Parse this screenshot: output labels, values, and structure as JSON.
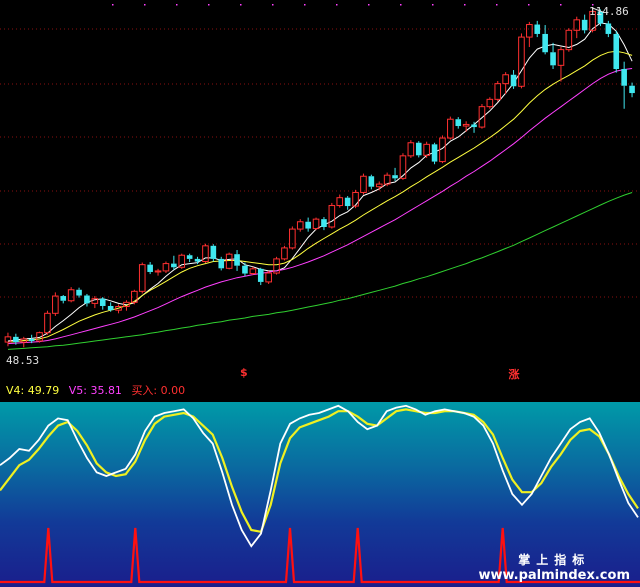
{
  "main_chart": {
    "high_label": "114.86",
    "low_label": "48.53",
    "signals": [
      {
        "text": "$",
        "date_index": 30
      },
      {
        "text": "涨",
        "date_index": 64
      }
    ]
  },
  "indicator_legend": {
    "v4": "V4: 49.79",
    "v5": "V5: 35.81",
    "buy": "买入: 0.00",
    "colors": {
      "v4": "#ffff40",
      "v5": "#ff40ff",
      "buy": "#ff3030"
    }
  },
  "watermark": {
    "cn": "掌上指标",
    "url": "www.palmindex.com"
  },
  "colors": {
    "up": "#ff3030",
    "down": "#40e8f0",
    "ma_short": "#ffffff",
    "ma_mid": "#ffff40",
    "ma_long": "#ff40ff",
    "ma_longer": "#30d030",
    "k_line": "#ffffff",
    "d_line": "#f0f020",
    "buy_line": "#ff1010"
  },
  "chart_data": [
    {
      "type": "candlestick",
      "title": "",
      "ylim": [
        48.53,
        114.86
      ],
      "candles": [
        [
          51.0,
          52.8,
          50.2,
          52.0
        ],
        [
          52.0,
          52.6,
          50.5,
          51.0
        ],
        [
          51.0,
          52.0,
          50.0,
          51.6
        ],
        [
          51.6,
          52.4,
          50.8,
          51.2
        ],
        [
          51.2,
          53.0,
          50.9,
          52.8
        ],
        [
          52.8,
          57.0,
          52.4,
          56.5
        ],
        [
          56.5,
          60.5,
          56.0,
          59.8
        ],
        [
          59.8,
          60.0,
          58.4,
          58.9
        ],
        [
          58.9,
          61.5,
          58.6,
          61.0
        ],
        [
          61.0,
          61.4,
          59.5,
          59.9
        ],
        [
          59.9,
          60.2,
          57.8,
          58.4
        ],
        [
          58.4,
          59.8,
          57.5,
          59.3
        ],
        [
          59.3,
          59.6,
          57.2,
          57.9
        ],
        [
          57.9,
          58.6,
          56.8,
          57.1
        ],
        [
          57.1,
          58.2,
          56.5,
          57.8
        ],
        [
          57.8,
          59.0,
          57.0,
          58.6
        ],
        [
          58.6,
          61.0,
          58.2,
          60.7
        ],
        [
          60.7,
          66.2,
          60.3,
          65.8
        ],
        [
          65.8,
          66.3,
          64.0,
          64.4
        ],
        [
          64.4,
          65.0,
          63.7,
          64.6
        ],
        [
          64.6,
          66.4,
          64.2,
          66.0
        ],
        [
          66.0,
          67.5,
          64.8,
          65.3
        ],
        [
          65.3,
          67.9,
          65.0,
          67.6
        ],
        [
          67.6,
          67.9,
          66.3,
          66.9
        ],
        [
          66.9,
          67.3,
          65.9,
          66.4
        ],
        [
          66.4,
          69.8,
          66.1,
          69.4
        ],
        [
          69.4,
          69.7,
          66.4,
          66.9
        ],
        [
          66.9,
          67.3,
          64.7,
          65.1
        ],
        [
          65.1,
          68.1,
          64.9,
          67.8
        ],
        [
          67.8,
          68.6,
          64.6,
          65.6
        ],
        [
          65.6,
          66.2,
          63.6,
          64.1
        ],
        [
          64.1,
          65.4,
          63.8,
          65.0
        ],
        [
          65.0,
          65.2,
          61.9,
          62.5
        ],
        [
          62.5,
          64.6,
          62.1,
          64.2
        ],
        [
          64.2,
          67.3,
          63.9,
          66.9
        ],
        [
          66.9,
          69.4,
          66.6,
          69.0
        ],
        [
          69.0,
          73.1,
          68.7,
          72.6
        ],
        [
          72.6,
          74.5,
          72.1,
          74.0
        ],
        [
          74.0,
          74.8,
          72.1,
          72.7
        ],
        [
          72.7,
          74.8,
          72.4,
          74.5
        ],
        [
          74.5,
          74.9,
          72.4,
          73.0
        ],
        [
          73.0,
          77.6,
          72.7,
          77.1
        ],
        [
          77.1,
          79.2,
          76.7,
          78.6
        ],
        [
          78.6,
          78.9,
          76.3,
          77.0
        ],
        [
          77.0,
          80.1,
          76.6,
          79.6
        ],
        [
          79.6,
          83.2,
          79.2,
          82.7
        ],
        [
          82.7,
          83.0,
          80.2,
          80.7
        ],
        [
          80.7,
          81.7,
          80.0,
          81.2
        ],
        [
          81.2,
          83.4,
          80.8,
          82.9
        ],
        [
          82.9,
          84.3,
          81.8,
          82.3
        ],
        [
          82.3,
          87.1,
          82.0,
          86.6
        ],
        [
          86.6,
          89.6,
          86.2,
          89.1
        ],
        [
          89.1,
          89.4,
          86.3,
          86.7
        ],
        [
          86.7,
          89.3,
          86.2,
          88.8
        ],
        [
          88.8,
          89.1,
          85.0,
          85.5
        ],
        [
          85.5,
          90.5,
          85.2,
          90.0
        ],
        [
          90.0,
          94.1,
          89.7,
          93.6
        ],
        [
          93.6,
          94.0,
          91.8,
          92.3
        ],
        [
          92.3,
          93.2,
          91.2,
          92.6
        ],
        [
          92.6,
          93.1,
          91.0,
          92.1
        ],
        [
          92.1,
          96.5,
          91.8,
          96.0
        ],
        [
          96.0,
          97.8,
          95.6,
          97.4
        ],
        [
          97.4,
          100.9,
          97.0,
          100.4
        ],
        [
          100.4,
          102.6,
          98.4,
          102.1
        ],
        [
          102.1,
          103.0,
          99.4,
          99.9
        ],
        [
          99.9,
          110.0,
          99.5,
          109.3
        ],
        [
          109.3,
          112.2,
          107.4,
          111.7
        ],
        [
          111.7,
          112.4,
          109.3,
          109.9
        ],
        [
          109.9,
          111.6,
          106.0,
          106.4
        ],
        [
          106.4,
          108.2,
          103.2,
          103.9
        ],
        [
          103.9,
          107.4,
          100.8,
          106.9
        ],
        [
          106.9,
          111.0,
          106.5,
          110.6
        ],
        [
          110.6,
          113.2,
          109.1,
          112.6
        ],
        [
          112.6,
          113.6,
          110.0,
          110.6
        ],
        [
          110.6,
          114.86,
          110.2,
          114.2
        ],
        [
          114.2,
          114.6,
          111.4,
          111.9
        ],
        [
          111.9,
          112.4,
          109.3,
          109.9
        ],
        [
          109.9,
          110.5,
          102.5,
          103.2
        ],
        [
          103.2,
          104.6,
          95.6,
          100.0
        ],
        [
          100.0,
          100.6,
          97.8,
          98.6
        ]
      ],
      "ma_series": [
        {
          "values": [
            51.2,
            51.4,
            51.6,
            51.7,
            51.9,
            52.7,
            54.0,
            55.1,
            56.3,
            57.6,
            58.6,
            59.1,
            59.3,
            58.9,
            58.4,
            58.1,
            58.5,
            59.9,
            61.1,
            62.2,
            63.6,
            64.8,
            65.8,
            66.0,
            66.2,
            67.1,
            67.1,
            66.6,
            66.8,
            66.9,
            65.8,
            65.4,
            64.9,
            64.6,
            64.6,
            65.2,
            67.0,
            69.0,
            71.0,
            72.6,
            73.4,
            74.1,
            75.2,
            75.9,
            77.2,
            79.0,
            79.6,
            80.3,
            81.3,
            81.6,
            82.8,
            84.3,
            85.3,
            86.7,
            87.3,
            88.0,
            89.4,
            90.2,
            91.4,
            92.6,
            93.9,
            95.2,
            96.8,
            98.6,
            100.5,
            102.9,
            105.3,
            107.0,
            107.6,
            107.9,
            107.6,
            107.3,
            107.9,
            108.9,
            110.9,
            112.0,
            111.8,
            110.4,
            107.8,
            104.7
          ]
        },
        {
          "values": [
            51.0,
            51.1,
            51.3,
            51.4,
            51.6,
            52.0,
            52.7,
            53.4,
            54.2,
            55.0,
            55.6,
            56.2,
            56.7,
            57.1,
            57.5,
            58.0,
            58.8,
            59.9,
            60.9,
            61.7,
            62.6,
            63.5,
            64.4,
            65.1,
            65.6,
            66.0,
            66.4,
            66.5,
            66.6,
            66.6,
            66.4,
            66.2,
            66.0,
            65.8,
            65.8,
            66.1,
            66.8,
            67.8,
            68.9,
            69.9,
            70.8,
            71.7,
            72.6,
            73.4,
            74.3,
            75.3,
            76.2,
            77.1,
            78.0,
            78.8,
            79.7,
            80.7,
            81.6,
            82.6,
            83.5,
            84.4,
            85.4,
            86.3,
            87.2,
            88.1,
            89.1,
            90.1,
            91.2,
            92.4,
            93.6,
            95.1,
            96.7,
            98.1,
            99.3,
            100.3,
            101.2,
            102.0,
            102.9,
            103.8,
            104.9,
            105.8,
            106.4,
            106.6,
            106.3,
            105.8
          ]
        },
        {
          "values": [
            50.7,
            50.8,
            50.9,
            51.0,
            51.1,
            51.3,
            51.6,
            52.0,
            52.4,
            52.8,
            53.2,
            53.6,
            54.0,
            54.4,
            54.8,
            55.3,
            55.8,
            56.4,
            57.0,
            57.6,
            58.3,
            59.0,
            59.7,
            60.3,
            60.9,
            61.5,
            62.0,
            62.5,
            62.9,
            63.3,
            63.6,
            63.9,
            64.1,
            64.4,
            64.6,
            64.9,
            65.3,
            65.8,
            66.3,
            66.9,
            67.5,
            68.2,
            68.9,
            69.6,
            70.4,
            71.2,
            72.0,
            72.8,
            73.6,
            74.4,
            75.3,
            76.2,
            77.1,
            78.0,
            78.9,
            79.8,
            80.8,
            81.7,
            82.7,
            83.6,
            84.6,
            85.6,
            86.7,
            87.8,
            88.9,
            90.1,
            91.4,
            92.6,
            93.8,
            94.9,
            96.0,
            97.1,
            98.2,
            99.3,
            100.4,
            101.4,
            102.2,
            102.8,
            103.1,
            103.3
          ]
        },
        {
          "values": [
            49.6,
            49.7,
            49.8,
            49.9,
            50.0,
            50.1,
            50.3,
            50.4,
            50.6,
            50.8,
            51.0,
            51.2,
            51.4,
            51.6,
            51.8,
            52.0,
            52.2,
            52.4,
            52.7,
            52.9,
            53.2,
            53.4,
            53.7,
            53.9,
            54.2,
            54.4,
            54.7,
            54.9,
            55.2,
            55.4,
            55.6,
            55.9,
            56.1,
            56.3,
            56.6,
            56.8,
            57.1,
            57.4,
            57.7,
            58.0,
            58.3,
            58.6,
            59.0,
            59.3,
            59.7,
            60.1,
            60.5,
            60.9,
            61.3,
            61.7,
            62.2,
            62.6,
            63.1,
            63.5,
            64.0,
            64.5,
            65.0,
            65.5,
            66.0,
            66.6,
            67.1,
            67.7,
            68.3,
            68.9,
            69.5,
            70.2,
            70.9,
            71.6,
            72.3,
            73.0,
            73.7,
            74.4,
            75.1,
            75.8,
            76.5,
            77.2,
            77.9,
            78.5,
            79.1,
            79.6
          ]
        }
      ]
    },
    {
      "type": "line",
      "title": "",
      "ylim": [
        0,
        100
      ],
      "series": [
        {
          "name": "V4",
          "values": [
            66,
            70,
            75,
            74,
            80,
            88,
            92,
            91,
            80,
            70,
            62,
            60,
            62,
            64,
            72,
            85,
            93,
            95,
            96,
            97,
            92,
            84,
            78,
            62,
            44,
            30,
            21,
            28,
            52,
            78,
            89,
            92,
            94,
            95,
            97,
            99,
            96,
            90,
            86,
            88,
            96,
            98,
            99,
            97,
            94,
            96,
            97,
            96,
            95,
            93,
            88,
            78,
            63,
            50,
            44,
            50,
            60,
            70,
            78,
            86,
            90,
            92,
            84,
            72,
            58,
            45,
            37
          ]
        },
        {
          "name": "V5",
          "values": [
            52,
            59,
            66,
            69,
            75,
            82,
            88,
            90,
            85,
            77,
            67,
            62,
            60,
            61,
            68,
            80,
            89,
            93,
            94,
            95,
            93,
            88,
            83,
            70,
            54,
            40,
            30,
            29,
            44,
            67,
            81,
            87,
            89,
            91,
            93,
            96,
            96,
            93,
            89,
            88,
            92,
            96,
            97,
            96,
            95,
            95,
            96,
            96,
            95,
            94,
            90,
            83,
            70,
            58,
            51,
            51,
            56,
            65,
            72,
            80,
            85,
            86,
            82,
            72,
            60,
            50,
            42
          ]
        },
        {
          "name": "买入",
          "values": [
            0,
            0,
            0,
            0,
            0,
            0,
            0,
            0,
            0,
            0,
            0,
            0,
            0,
            0,
            0,
            0,
            0,
            0,
            0,
            0,
            0,
            0,
            0,
            0,
            0,
            0,
            0,
            0,
            0,
            0,
            0,
            0,
            0,
            0,
            0,
            0,
            0,
            0,
            0,
            0,
            0,
            0,
            0,
            0,
            0,
            0,
            0,
            0,
            0,
            0,
            0,
            0,
            0,
            0,
            0,
            0,
            0,
            0,
            0,
            0,
            0,
            0,
            0,
            0,
            0,
            0,
            0
          ]
        }
      ],
      "buy_signal_indices": [
        5,
        14,
        30,
        37,
        52
      ],
      "buy_signal_height": 30
    }
  ]
}
